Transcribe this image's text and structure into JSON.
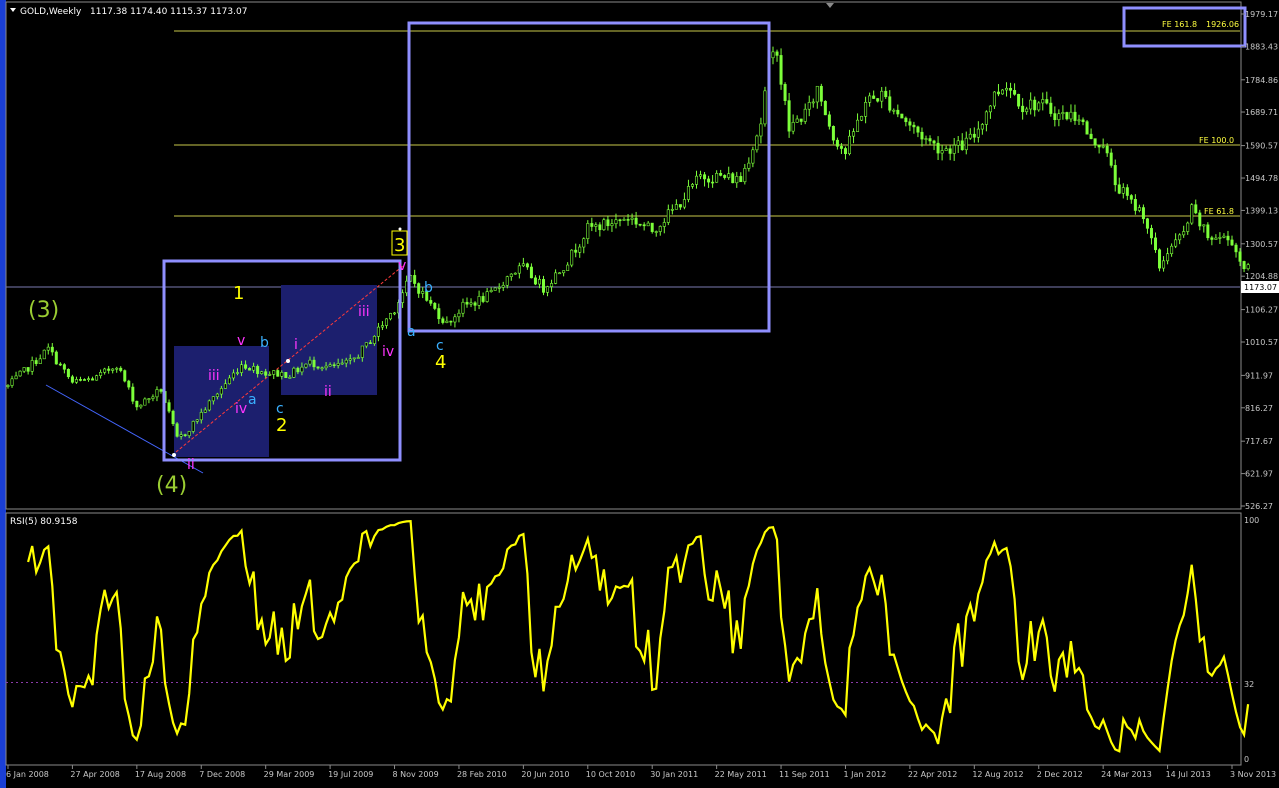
{
  "window": {
    "title": "GOLD,Weekly",
    "ohlc": "1117.38 1174.40 1115.37 1173.07"
  },
  "rsi_panel": {
    "title": "RSI(5) 80.9158"
  },
  "colors": {
    "background": "#000000",
    "candle": "#7cff3a",
    "rsi_line": "#ffff00",
    "fib_lines": "#c9c94a",
    "box_outline": "#8f8fff",
    "box_fill": "#1c1f6e",
    "wave_olive": "#9acd32",
    "wave_yellow": "#ffff00",
    "wave_magenta": "#ff35ff",
    "wave_cyan": "#3ab0ff",
    "axis_text": "#c8c8c8"
  },
  "chart_data": [
    {
      "type": "candlestick",
      "symbol": "GOLD",
      "timeframe": "Weekly",
      "price_ticks": [
        "1979.17",
        "1883.43",
        "1784.86",
        "1689.71",
        "1590.57",
        "1494.78",
        "1399.13",
        "1300.57",
        "1204.88",
        "1106.27",
        "1010.57",
        "911.97",
        "816.27",
        "717.67",
        "621.97",
        "526.27"
      ],
      "current_price": "1173.07",
      "x_ticks": [
        "6 Jan 2008",
        "27 Apr 2008",
        "17 Aug 2008",
        "7 Dec 2008",
        "29 Mar 2009",
        "19 Jul 2009",
        "8 Nov 2009",
        "28 Feb 2010",
        "20 Jun 2010",
        "10 Oct 2010",
        "30 Jan 2011",
        "22 May 2011",
        "11 Sep 2011",
        "1 Jan 2012",
        "22 Apr 2012",
        "12 Aug 2012",
        "2 Dec 2012",
        "24 Mar 2013",
        "14 Jul 2013",
        "3 Nov 2013"
      ],
      "ylim": [
        526.27,
        1979.17
      ],
      "series": [
        {
          "approximate_closes": [
            [
              "2008-01-06",
              880
            ],
            [
              "2008-03-16",
              990
            ],
            [
              "2008-04-27",
              890
            ],
            [
              "2008-06-08",
              905
            ],
            [
              "2008-07-13",
              945
            ],
            [
              "2008-08-17",
              820
            ],
            [
              "2008-09-28",
              870
            ],
            [
              "2008-10-26",
              725
            ],
            [
              "2008-11-09",
              740
            ],
            [
              "2008-12-07",
              800
            ],
            [
              "2009-01-04",
              860
            ],
            [
              "2009-02-15",
              945
            ],
            [
              "2009-03-29",
              920
            ],
            [
              "2009-05-10",
              915
            ],
            [
              "2009-06-14",
              950
            ],
            [
              "2009-07-19",
              935
            ],
            [
              "2009-08-23",
              950
            ],
            [
              "2009-09-20",
              1000
            ],
            [
              "2009-11-08",
              1110
            ],
            [
              "2009-12-06",
              1200
            ],
            [
              "2010-01-10",
              1120
            ],
            [
              "2010-02-07",
              1065
            ],
            [
              "2010-03-07",
              1115
            ],
            [
              "2010-04-25",
              1150
            ],
            [
              "2010-05-30",
              1215
            ],
            [
              "2010-06-20",
              1230
            ],
            [
              "2010-07-25",
              1170
            ],
            [
              "2010-09-05",
              1250
            ],
            [
              "2010-10-10",
              1345
            ],
            [
              "2010-11-14",
              1360
            ],
            [
              "2010-12-19",
              1380
            ],
            [
              "2011-01-30",
              1340
            ],
            [
              "2011-03-13",
              1410
            ],
            [
              "2011-04-24",
              1500
            ],
            [
              "2011-05-22",
              1500
            ],
            [
              "2011-07-03",
              1490
            ],
            [
              "2011-08-07",
              1660
            ],
            [
              "2011-08-21",
              1830
            ],
            [
              "2011-09-04",
              1880
            ],
            [
              "2011-09-11",
              1780
            ],
            [
              "2011-09-25",
              1640
            ],
            [
              "2011-10-30",
              1700
            ],
            [
              "2011-11-13",
              1760
            ],
            [
              "2011-12-11",
              1620
            ],
            [
              "2012-01-01",
              1570
            ],
            [
              "2012-02-05",
              1720
            ],
            [
              "2012-03-04",
              1740
            ],
            [
              "2012-04-22",
              1650
            ],
            [
              "2012-05-27",
              1600
            ],
            [
              "2012-06-17",
              1580
            ],
            [
              "2012-07-22",
              1590
            ],
            [
              "2012-08-12",
              1620
            ],
            [
              "2012-09-16",
              1740
            ],
            [
              "2012-10-07",
              1775
            ],
            [
              "2012-11-04",
              1710
            ],
            [
              "2012-12-02",
              1715
            ],
            [
              "2013-01-06",
              1680
            ],
            [
              "2013-02-10",
              1680
            ],
            [
              "2013-03-03",
              1600
            ],
            [
              "2013-03-24",
              1600
            ],
            [
              "2013-04-14",
              1480
            ],
            [
              "2013-05-12",
              1420
            ],
            [
              "2013-06-02",
              1390
            ],
            [
              "2013-06-30",
              1230
            ],
            [
              "2013-07-14",
              1280
            ],
            [
              "2013-08-11",
              1330
            ],
            [
              "2013-08-25",
              1400
            ],
            [
              "2013-09-22",
              1320
            ],
            [
              "2013-10-13",
              1320
            ],
            [
              "2013-11-03",
              1310
            ],
            [
              "2013-11-17",
              1250
            ],
            [
              "2013-12-01",
              1225
            ]
          ]
        }
      ],
      "fib_levels": [
        {
          "label": "FE 161.8",
          "value": "1926.06"
        },
        {
          "label": "FE 100.0",
          "value": ""
        },
        {
          "label": "FE 61.8",
          "value": ""
        }
      ],
      "wave_labels": {
        "olive": [
          "(3)",
          "(4)"
        ],
        "yellow": [
          "1",
          "2",
          "3",
          "4"
        ],
        "magenta": [
          "i",
          "ii",
          "iii",
          "iv",
          "v"
        ],
        "cyan": [
          "a",
          "b",
          "c"
        ]
      }
    },
    {
      "type": "line",
      "title": "RSI(5) 80.9158",
      "y_ticks": [
        "100",
        "32",
        "0"
      ],
      "ylim": [
        0,
        100
      ],
      "reference_level": 32
    }
  ]
}
